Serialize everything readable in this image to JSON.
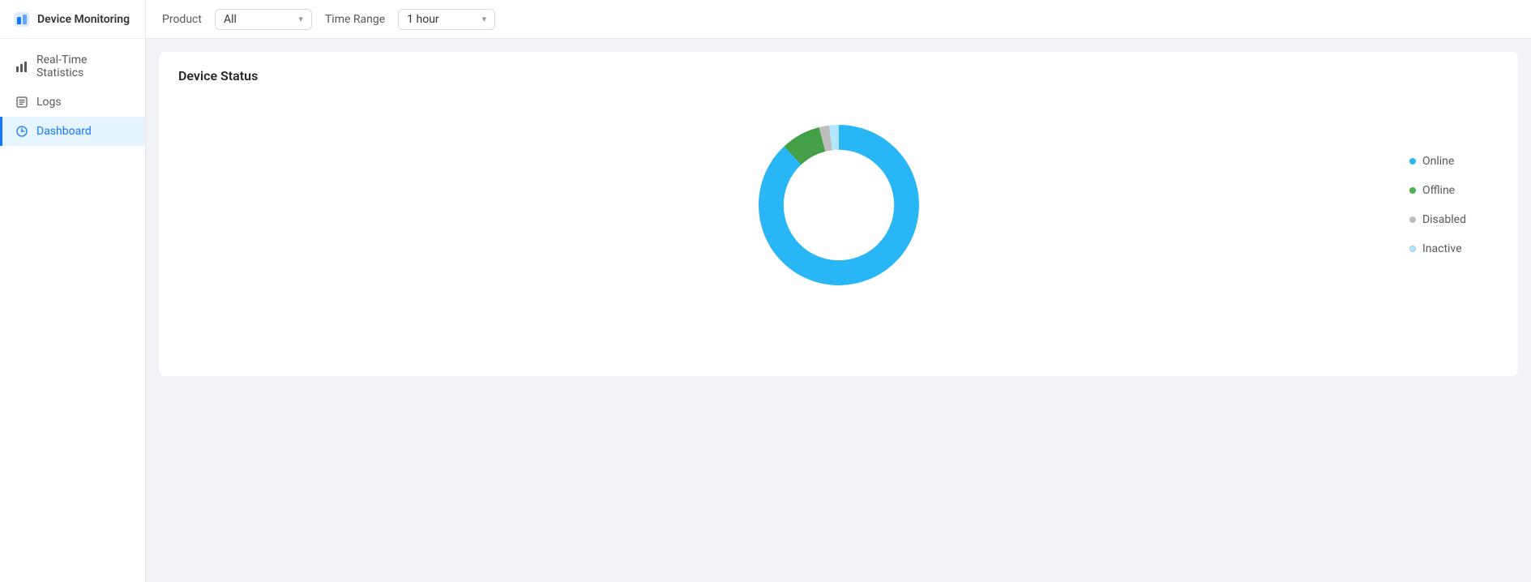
{
  "sidebar": {
    "logo": {
      "text": "Device Monitoring"
    },
    "items": [
      {
        "id": "real-time-statistics",
        "label": "Real-Time Statistics",
        "icon": "chart-icon",
        "active": false
      },
      {
        "id": "logs",
        "label": "Logs",
        "icon": "logs-icon",
        "active": false
      },
      {
        "id": "dashboard",
        "label": "Dashboard",
        "icon": "dashboard-icon",
        "active": true
      }
    ]
  },
  "toolbar": {
    "product_label": "Product",
    "product_value": "All",
    "time_range_label": "Time Range",
    "time_range_value": "1 hour"
  },
  "card": {
    "title": "Device Status"
  },
  "legend": {
    "items": [
      {
        "label": "Online",
        "color": "#29b6f6"
      },
      {
        "label": "Offline",
        "color": "#4caf50"
      },
      {
        "label": "Disabled",
        "color": "#bdbdbd"
      },
      {
        "label": "Inactive",
        "color": "#b3e5fc"
      }
    ]
  },
  "chart": {
    "online_percent": 88,
    "offline_percent": 8,
    "disabled_percent": 2,
    "inactive_percent": 2,
    "colors": {
      "online": "#29b6f6",
      "offline": "#43a047",
      "disabled": "#bdbdbd",
      "inactive": "#b3e5fc"
    }
  }
}
